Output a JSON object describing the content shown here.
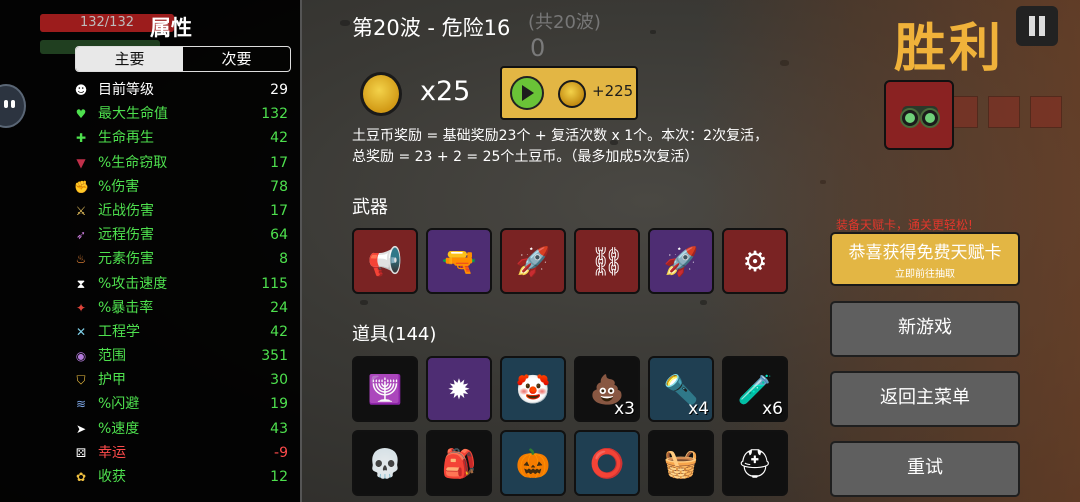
{
  "player": {
    "hp_text": "132/132",
    "hp_fraction": 1.0
  },
  "stats_panel": {
    "title": "属性",
    "tabs": [
      "主要",
      "次要"
    ],
    "active_tab": 0,
    "items": [
      {
        "label": "目前等级",
        "value": "29",
        "label_color": "#ffffff",
        "value_color": "#ffffff",
        "icon": "head-icon"
      },
      {
        "label": "最大生命值",
        "value": "132",
        "label_color": "#4ee04e",
        "value_color": "#4ee04e",
        "icon": "heart-icon"
      },
      {
        "label": "生命再生",
        "value": "42",
        "label_color": "#4ee04e",
        "value_color": "#4ee04e",
        "icon": "syringe-icon"
      },
      {
        "label": "%生命窃取",
        "value": "17",
        "label_color": "#4ee04e",
        "value_color": "#4ee04e",
        "icon": "fangs-icon"
      },
      {
        "label": "%伤害",
        "value": "78",
        "label_color": "#4ee04e",
        "value_color": "#4ee04e",
        "icon": "muscle-icon"
      },
      {
        "label": "近战伤害",
        "value": "17",
        "label_color": "#4ee04e",
        "value_color": "#4ee04e",
        "icon": "sword-icon"
      },
      {
        "label": "远程伤害",
        "value": "64",
        "label_color": "#4ee04e",
        "value_color": "#4ee04e",
        "icon": "bow-icon"
      },
      {
        "label": "元素伤害",
        "value": "8",
        "label_color": "#4ee04e",
        "value_color": "#4ee04e",
        "icon": "flame-icon"
      },
      {
        "label": "%攻击速度",
        "value": "115",
        "label_color": "#4ee04e",
        "value_color": "#4ee04e",
        "icon": "hourglass-icon"
      },
      {
        "label": "%暴击率",
        "value": "24",
        "label_color": "#4ee04e",
        "value_color": "#4ee04e",
        "icon": "crit-icon"
      },
      {
        "label": "工程学",
        "value": "42",
        "label_color": "#4ee04e",
        "value_color": "#4ee04e",
        "icon": "wrench-icon"
      },
      {
        "label": "范围",
        "value": "351",
        "label_color": "#4ee04e",
        "value_color": "#4ee04e",
        "icon": "range-icon"
      },
      {
        "label": "护甲",
        "value": "30",
        "label_color": "#4ee04e",
        "value_color": "#4ee04e",
        "icon": "shield-icon"
      },
      {
        "label": "%闪避",
        "value": "19",
        "label_color": "#4ee04e",
        "value_color": "#4ee04e",
        "icon": "dodge-icon"
      },
      {
        "label": "%速度",
        "value": "43",
        "label_color": "#4ee04e",
        "value_color": "#4ee04e",
        "icon": "speed-icon"
      },
      {
        "label": "幸运",
        "value": "-9",
        "label_color": "#ff4b4b",
        "value_color": "#ff4b4b",
        "icon": "dice-icon"
      },
      {
        "label": "收获",
        "value": "12",
        "label_color": "#4ee04e",
        "value_color": "#4ee04e",
        "icon": "harvest-icon"
      }
    ]
  },
  "wave": {
    "title": "第20波 - 危险16",
    "ghost_text": "(共20波)",
    "ghost_number": "0"
  },
  "reward": {
    "coin_count": "x25",
    "bonus_text": "+225",
    "description_line1": "土豆币奖励 = 基础奖励23个 + 复活次数 x 1个。本次：2次复活，",
    "description_line2": "总奖励 = 23 + 2 = 25个土豆币。（最多加成5次复活）"
  },
  "weapons": {
    "title": "武器",
    "slots": [
      {
        "tier": "red",
        "icon": "megaphone-icon",
        "glyph": "📢"
      },
      {
        "tier": "purple",
        "icon": "ray-gun-icon",
        "glyph": "🔫"
      },
      {
        "tier": "red",
        "icon": "rocket-launcher-icon",
        "glyph": "🚀"
      },
      {
        "tier": "red",
        "icon": "chain-icon",
        "glyph": "⛓"
      },
      {
        "tier": "purple",
        "icon": "rocket-launcher-icon",
        "glyph": "🚀"
      },
      {
        "tier": "red",
        "icon": "minigun-icon",
        "glyph": "⚙"
      }
    ]
  },
  "items": {
    "title": "道具(144)",
    "slots": [
      {
        "tier": "black",
        "icon": "totem-icon",
        "glyph": "🕎",
        "qty": ""
      },
      {
        "tier": "purple",
        "icon": "spiked-ball-icon",
        "glyph": "✹",
        "qty": ""
      },
      {
        "tier": "blue",
        "icon": "clown-icon",
        "glyph": "🤡",
        "qty": ""
      },
      {
        "tier": "black",
        "icon": "poop-icon",
        "glyph": "💩",
        "qty": "x3"
      },
      {
        "tier": "blue",
        "icon": "flashlight-icon",
        "glyph": "🔦",
        "qty": "x4"
      },
      {
        "tier": "black",
        "icon": "jar-icon",
        "glyph": "🧪",
        "qty": "x6"
      },
      {
        "tier": "black",
        "icon": "mummy-icon",
        "glyph": "💀",
        "qty": ""
      },
      {
        "tier": "black",
        "icon": "bag-icon",
        "glyph": "🎒",
        "qty": ""
      },
      {
        "tier": "blue",
        "icon": "pumpkin-icon",
        "glyph": "🎃",
        "qty": ""
      },
      {
        "tier": "blue",
        "icon": "belt-icon",
        "glyph": "⭕",
        "qty": ""
      },
      {
        "tier": "black",
        "icon": "sack-icon",
        "glyph": "🧺",
        "qty": ""
      },
      {
        "tier": "black",
        "icon": "helmet-icon",
        "glyph": "⛑",
        "qty": ""
      }
    ]
  },
  "right_panel": {
    "victory_text": "胜利",
    "talent_promo": "装备天赋卡，通关更轻松!",
    "talent_button_main": "恭喜获得免费天赋卡",
    "talent_button_sub": "立即前往抽取",
    "new_game": "新游戏",
    "main_menu": "返回主菜单",
    "retry": "重试"
  }
}
